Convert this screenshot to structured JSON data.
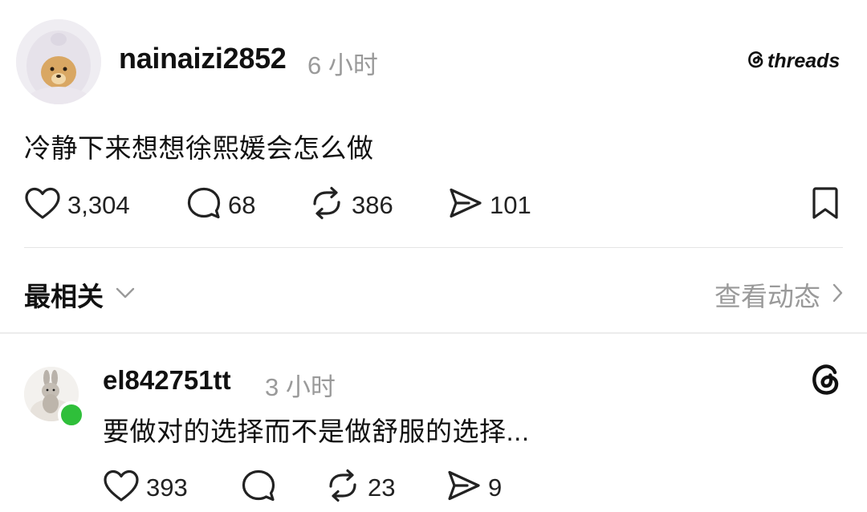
{
  "post": {
    "username": "nainaizi2852",
    "time": "6 小时",
    "text": "冷静下来想想徐熙媛会怎么做",
    "likes": "3,304",
    "comments": "68",
    "reposts": "386",
    "shares": "101"
  },
  "brand": {
    "name": "threads"
  },
  "sort": {
    "label": "最相关"
  },
  "activity": {
    "label": "查看动态"
  },
  "reply": {
    "username": "el842751tt",
    "time": "3 小时",
    "text": "要做对的选择而不是做舒服的选择...",
    "likes": "393",
    "comments": "",
    "reposts": "23",
    "shares": "9"
  },
  "icons": {
    "like": "heart-icon",
    "comment": "comment-bubble-icon",
    "repost": "repost-icon",
    "share": "send-icon",
    "save": "bookmark-icon",
    "sort": "chevron-down-icon",
    "activity": "chevron-right-icon",
    "threads": "threads-logo-icon"
  },
  "colors": {
    "text": "#111111",
    "muted": "#9a9a9a",
    "online": "#2fbf3a",
    "divider": "#e4e4e4"
  }
}
